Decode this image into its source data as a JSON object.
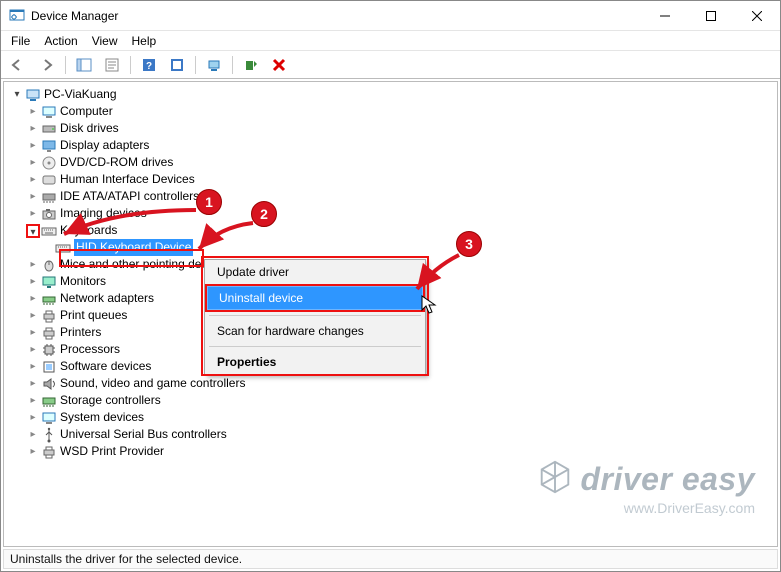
{
  "window": {
    "title": "Device Manager"
  },
  "menu": {
    "file": "File",
    "action": "Action",
    "view": "View",
    "help": "Help"
  },
  "tree": {
    "root": "PC-ViaKuang",
    "keyboards": {
      "label": "Keyboards",
      "child": "HID Keyboard Device"
    },
    "nodes": {
      "computer": "Computer",
      "disk": "Disk drives",
      "display": "Display adapters",
      "dvd": "DVD/CD-ROM drives",
      "hid": "Human Interface Devices",
      "ide": "IDE ATA/ATAPI controllers",
      "imaging": "Imaging devices",
      "mice": "Mice and other pointing devices",
      "monitors": "Monitors",
      "network": "Network adapters",
      "pqueue": "Print queues",
      "printers": "Printers",
      "processors": "Processors",
      "software": "Software devices",
      "sound": "Sound, video and game controllers",
      "storage": "Storage controllers",
      "system": "System devices",
      "usb": "Universal Serial Bus controllers",
      "wsd": "WSD Print Provider"
    }
  },
  "context": {
    "update": "Update driver",
    "uninstall": "Uninstall device",
    "scan": "Scan for hardware changes",
    "properties": "Properties"
  },
  "annotations": {
    "b1": "1",
    "b2": "2",
    "b3": "3"
  },
  "status": "Uninstalls the driver for the selected device.",
  "watermark": {
    "brand": "driver easy",
    "url": "www.DriverEasy.com"
  }
}
